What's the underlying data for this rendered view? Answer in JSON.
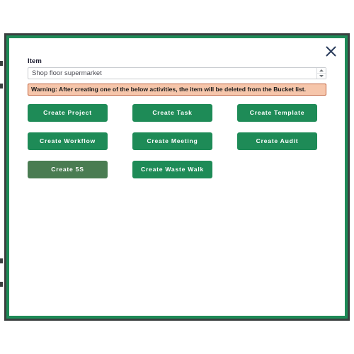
{
  "dialog": {
    "close_icon": "close-icon",
    "field": {
      "label": "Item",
      "value": "Shop floor supermarket",
      "placeholder": "Shop floor supermarket",
      "spinner_up_icon": "chevron-up-icon",
      "spinner_down_icon": "chevron-down-icon"
    },
    "warning": {
      "text": "Warning: After creating one of the below activities, the item will be deleted from the Bucket list."
    },
    "buttons": [
      [
        {
          "label": "Create Project",
          "state": "normal"
        },
        {
          "label": "Create Task",
          "state": "normal"
        },
        {
          "label": "Create Template",
          "state": "normal"
        }
      ],
      [
        {
          "label": "Create Workflow",
          "state": "normal"
        },
        {
          "label": "Create Meeting",
          "state": "normal"
        },
        {
          "label": "Create Audit",
          "state": "normal"
        }
      ],
      [
        {
          "label": "Create 5S",
          "state": "hovered"
        },
        {
          "label": "Create Waste Walk",
          "state": "normal"
        },
        {
          "label": "",
          "state": "empty"
        }
      ]
    ]
  },
  "colors": {
    "accent_green": "#1e8b57",
    "button_hover_green": "#4a7c52",
    "frame_dark": "#3a3f3f",
    "warning_bg": "#f6c6ab",
    "warning_border": "#c0603a",
    "close_icon": "#2d3e5e"
  }
}
